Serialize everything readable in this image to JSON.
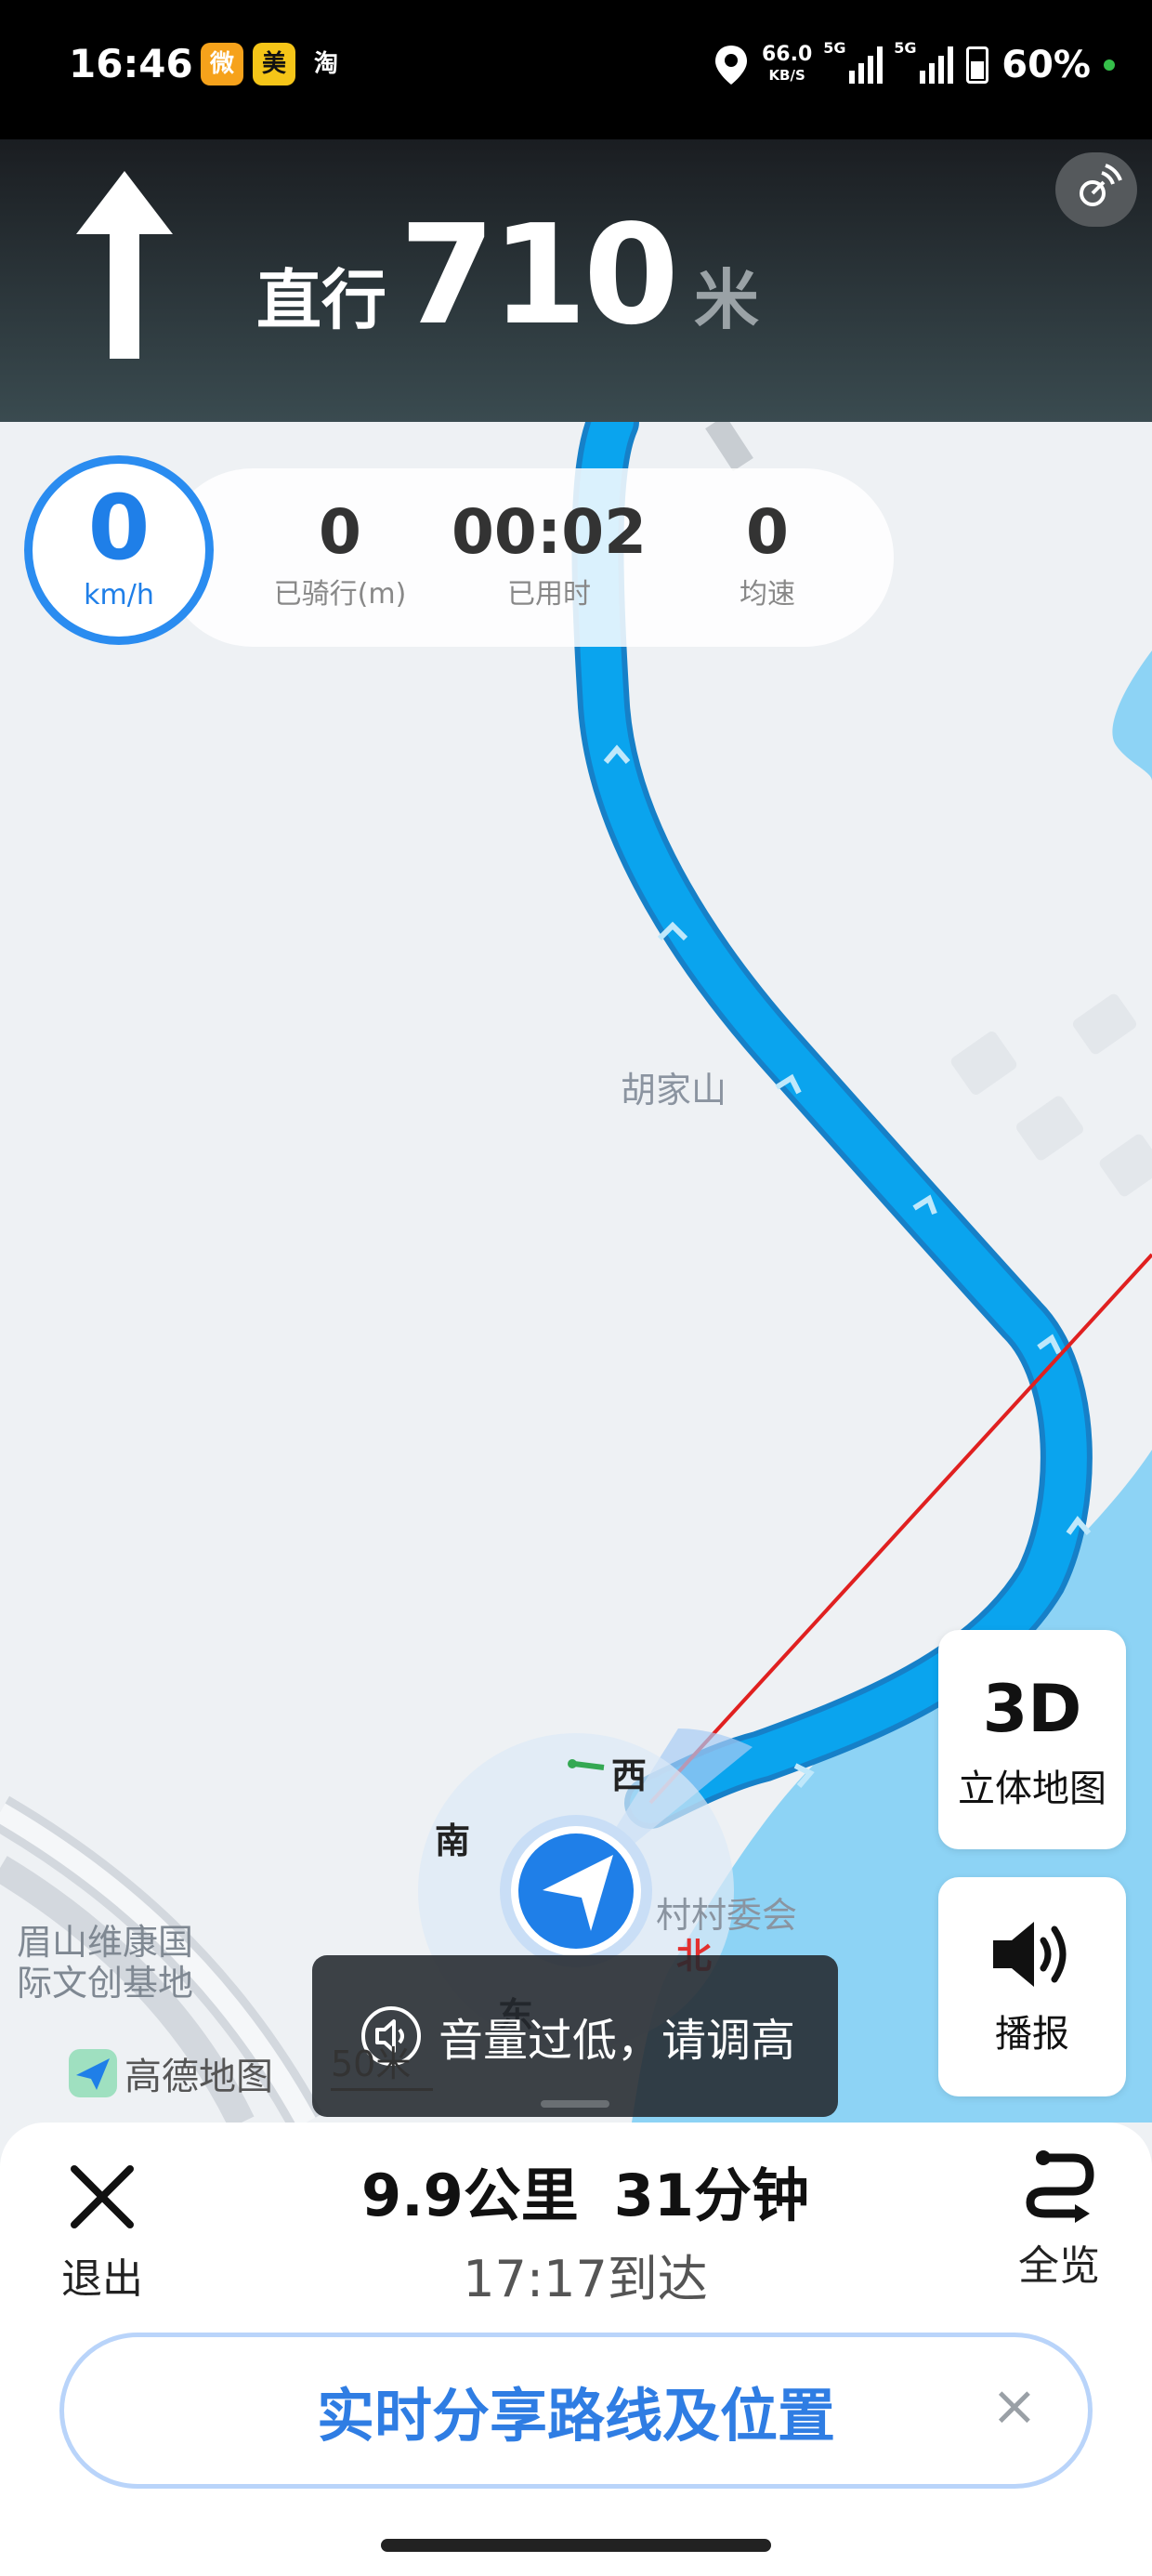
{
  "status_bar": {
    "time": "16:46",
    "app_icons": [
      {
        "name": "weibo-icon",
        "glyph": "微",
        "color": "#f6a21b"
      },
      {
        "name": "meituan-icon",
        "glyph": "美",
        "color": "#f5c518"
      },
      {
        "name": "taobao-icon",
        "glyph": "淘",
        "color": "#000000"
      }
    ],
    "net_speed_value": "66.0",
    "net_speed_unit": "KB/S",
    "signal_1_tag": "5G",
    "signal_2_tag": "5G",
    "battery": "60%"
  },
  "navigation": {
    "maneuver": "straight-arrow-icon",
    "action": "直行",
    "distance": "710",
    "unit": "米"
  },
  "trip_stats": {
    "speed": "0",
    "speed_unit": "km/h",
    "items": [
      {
        "value": "0",
        "label": "已骑行(m)"
      },
      {
        "value": "00:02",
        "label": "已用时"
      },
      {
        "value": "0",
        "label": "均速"
      }
    ]
  },
  "map": {
    "place_label": "胡家山",
    "poi_label_line1": "眉山维康国",
    "poi_label_line2": "际文创基地",
    "village_label": "村村委会",
    "compass": {
      "north": "北",
      "south": "南",
      "east": "东",
      "west": "西"
    },
    "logo_text": "高德地图",
    "scale_text": "50米",
    "colors": {
      "route": "#0aa4ee",
      "water": "#8dd3f5",
      "heading_line": "#e02020"
    }
  },
  "side_buttons": {
    "view_3d_big": "3D",
    "view_3d_label": "立体地图",
    "broadcast_label": "播报"
  },
  "toast": {
    "text": "音量过低，请调高"
  },
  "bottom_panel": {
    "exit_label": "退出",
    "distance": "9.9公里",
    "duration": "31分钟",
    "arrival": "17:17到达",
    "overview_label": "全览",
    "share_label": "实时分享路线及位置"
  }
}
